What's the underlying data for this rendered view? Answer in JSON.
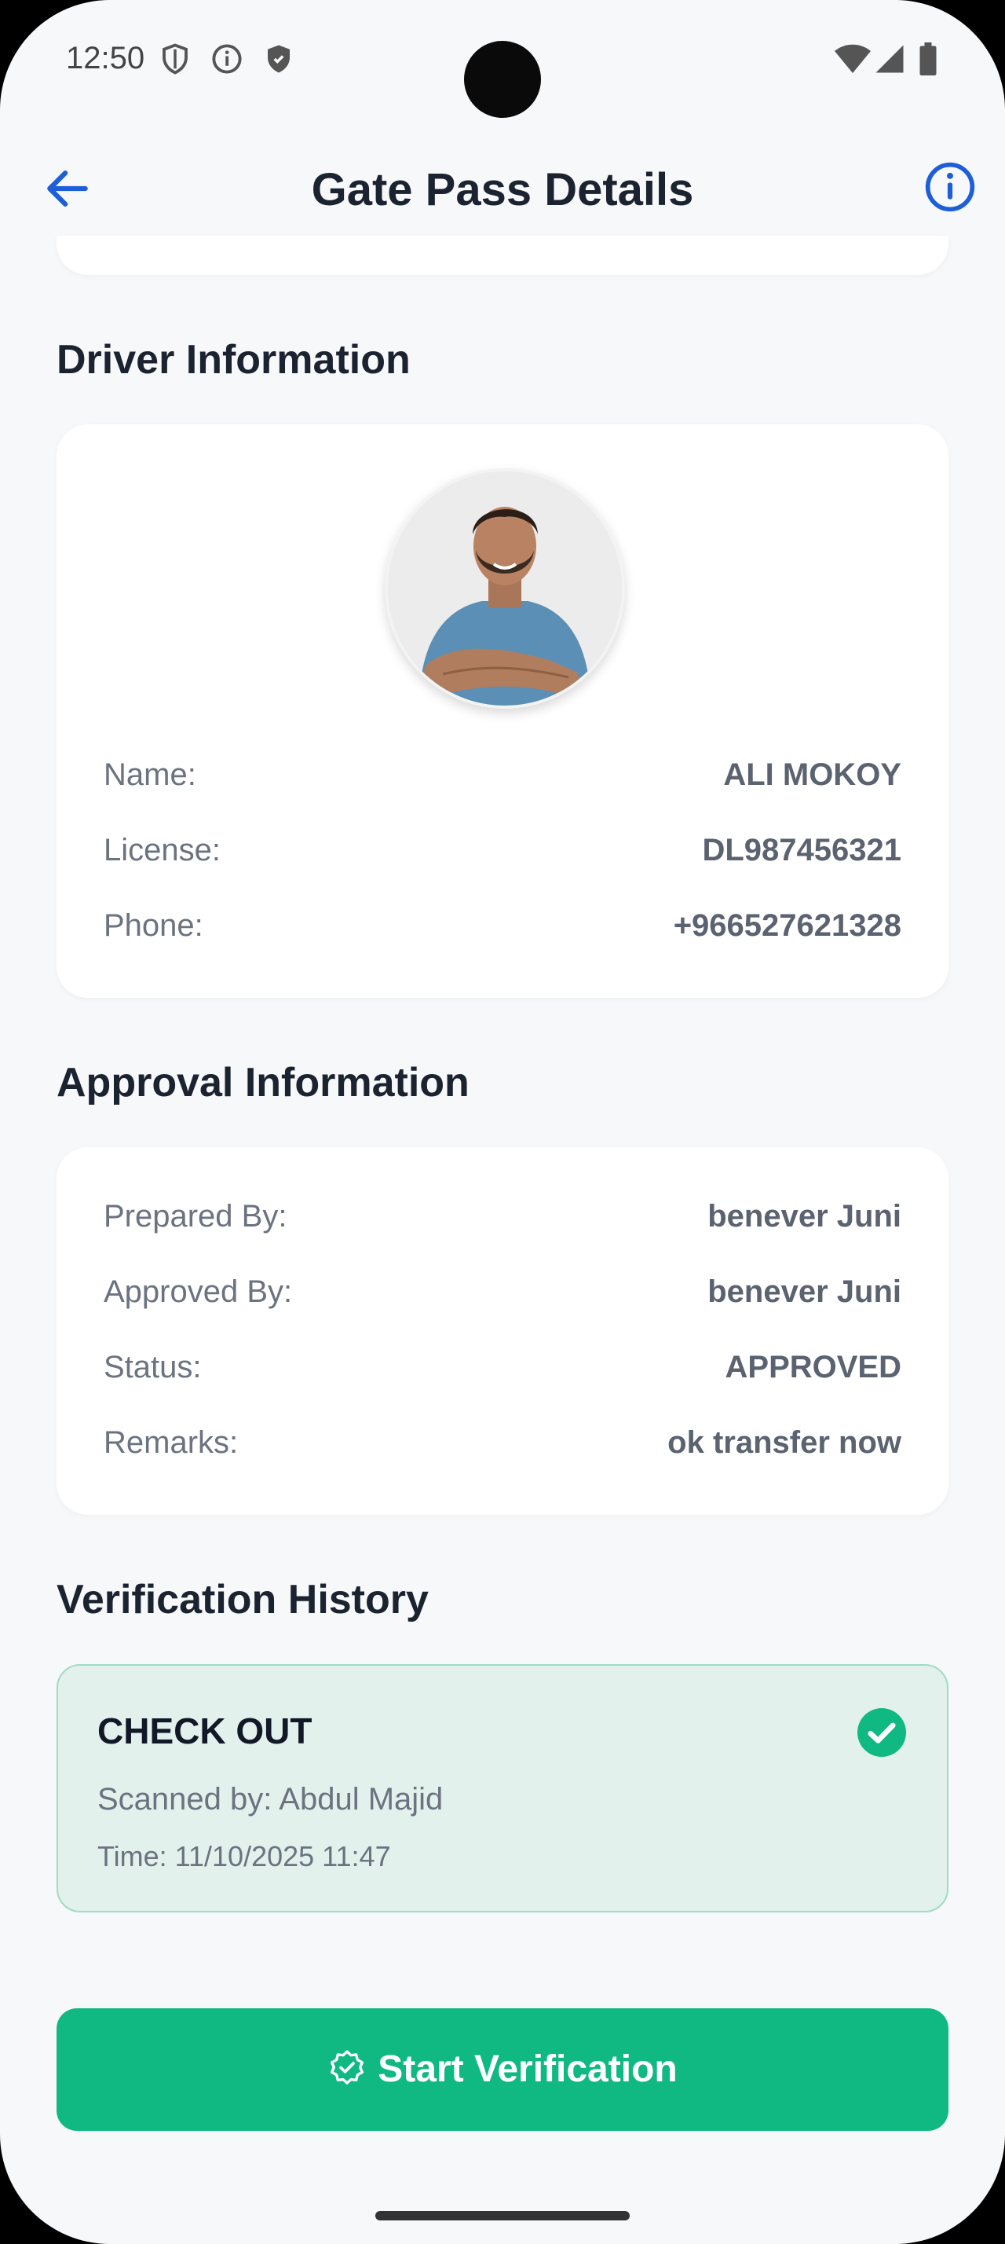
{
  "status_bar": {
    "time": "12:50",
    "left_icons": [
      "shield-outline-icon",
      "info-circle-icon",
      "shield-filled-icon"
    ],
    "right_icons": [
      "wifi-icon",
      "signal-icon",
      "battery-icon"
    ]
  },
  "app_bar": {
    "title": "Gate Pass Details",
    "back_icon": "arrow-left-icon",
    "info_icon": "info-circle-icon",
    "accent": "#1E5FD9"
  },
  "driver": {
    "section_title": "Driver Information",
    "avatar": "driver-avatar",
    "rows": [
      {
        "label": "Name:",
        "value": "ALI MOKOY"
      },
      {
        "label": "License:",
        "value": "DL987456321"
      },
      {
        "label": "Phone:",
        "value": "+966527621328"
      }
    ]
  },
  "approval": {
    "section_title": "Approval Information",
    "rows": [
      {
        "label": "Prepared By:",
        "value": "benever Juni"
      },
      {
        "label": "Approved By:",
        "value": "benever Juni"
      },
      {
        "label": "Status:",
        "value": "APPROVED"
      },
      {
        "label": "Remarks:",
        "value": "ok transfer now"
      }
    ]
  },
  "history": {
    "section_title": "Verification History",
    "entries": [
      {
        "type": "CHECK OUT",
        "scanned_by": "Scanned by: Abdul Majid",
        "time": "Time: 11/10/2025 11:47",
        "status_icon": "check-circle-icon",
        "color": "#10B981"
      }
    ]
  },
  "action": {
    "label": "Start Verification",
    "icon": "verified-badge-icon",
    "color": "#10B981"
  }
}
